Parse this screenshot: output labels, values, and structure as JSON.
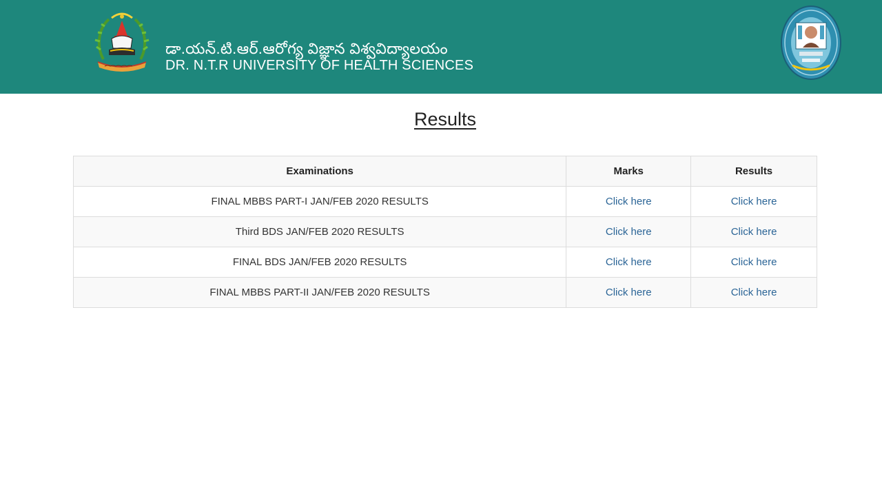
{
  "header": {
    "brand_telugu": "డా.యన్.టి.ఆర్.ఆరోగ్య విజ్ఞాన విశ్వవిద్యాలయం",
    "brand_english": "DR. N.T.R UNIVERSITY OF HEALTH SCIENCES",
    "background_color": "#1e877c",
    "left_logo_icon": "university-emblem-icon",
    "right_logo_icon": "naac-seal-icon"
  },
  "main": {
    "title": "Results",
    "table": {
      "headers": [
        "Examinations",
        "Marks",
        "Results"
      ],
      "rows": [
        {
          "exam": "FINAL MBBS PART-I JAN/FEB 2020 RESULTS",
          "marks": "Click here",
          "results": "Click here"
        },
        {
          "exam": "Third BDS JAN/FEB 2020 RESULTS",
          "marks": "Click here",
          "results": "Click here"
        },
        {
          "exam": "FINAL BDS JAN/FEB 2020 RESULTS",
          "marks": "Click here",
          "results": "Click here"
        },
        {
          "exam": "FINAL MBBS PART-II JAN/FEB 2020 RESULTS",
          "marks": "Click here",
          "results": "Click here"
        }
      ]
    },
    "link_color": "#2a6496"
  }
}
